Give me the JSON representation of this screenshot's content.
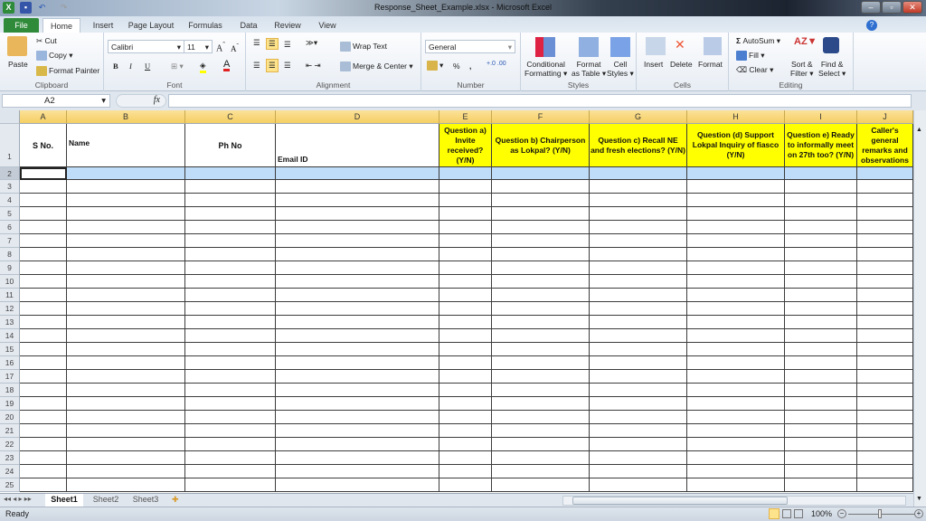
{
  "window": {
    "title": "Response_Sheet_Example.xlsx  -  Microsoft Excel"
  },
  "tabs": [
    "File",
    "Home",
    "Insert",
    "Page Layout",
    "Formulas",
    "Data",
    "Review",
    "View"
  ],
  "ribbon": {
    "clipboard": {
      "label": "Clipboard",
      "paste": "Paste",
      "cut": "Cut",
      "copy": "Copy",
      "format_painter": "Format Painter"
    },
    "font": {
      "label": "Font",
      "name": "Calibri",
      "size": "11",
      "bold": "B",
      "italic": "I",
      "underline": "U"
    },
    "alignment": {
      "label": "Alignment",
      "wrap_text": "Wrap Text",
      "merge_center": "Merge & Center"
    },
    "number": {
      "label": "Number",
      "format": "General",
      "percent": "%",
      "comma": ","
    },
    "styles": {
      "label": "Styles",
      "conditional_formatting": [
        "Conditional",
        "Formatting ▾"
      ],
      "format_as_table": [
        "Format",
        "as Table ▾"
      ],
      "cell_styles": [
        "Cell",
        "Styles ▾"
      ]
    },
    "cells": {
      "label": "Cells",
      "insert": "Insert",
      "delete": "Delete",
      "format": "Format"
    },
    "editing": {
      "label": "Editing",
      "autosum": "AutoSum",
      "fill": "Fill",
      "clear": "Clear",
      "sort_filter": [
        "Sort &",
        "Filter ▾"
      ],
      "find_select": [
        "Find &",
        "Select ▾"
      ]
    }
  },
  "formula_bar": {
    "name_box": "A2",
    "fx": "fx",
    "value": ""
  },
  "sheet": {
    "columns": [
      "A",
      "B",
      "C",
      "D",
      "E",
      "F",
      "G",
      "H",
      "I",
      "J"
    ],
    "header_row": [
      "S No.",
      "Name",
      "Ph No",
      "Email ID",
      "Question a) Invite received? (Y/N)",
      "Question b) Chairperson as Lokpal? (Y/N)",
      "Question c) Recall NE and fresh elections? (Y/N)",
      "Question (d) Support Lokpal Inquiry of fiasco (Y/N)",
      "Question e) Ready to informally meet on 27th too? (Y/N)",
      "Caller's general remarks and observations"
    ],
    "rows": [
      "1",
      "2",
      "3",
      "4",
      "5",
      "6",
      "7",
      "8",
      "9",
      "10",
      "11",
      "12",
      "13",
      "14",
      "15",
      "16",
      "17",
      "18",
      "19",
      "20",
      "21",
      "22",
      "23",
      "24",
      "25"
    ],
    "selected_cell": "A2",
    "highlight_color": "#bfdcf8",
    "header_fill": "#ffff00"
  },
  "sheet_tabs": [
    "Sheet1",
    "Sheet2",
    "Sheet3"
  ],
  "active_sheet": "Sheet1",
  "status": {
    "text": "Ready",
    "zoom": "100%"
  }
}
